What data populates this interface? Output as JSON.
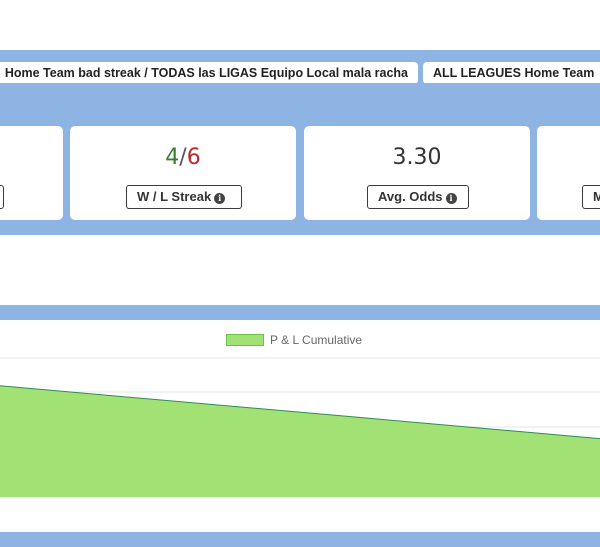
{
  "tabs": [
    {
      "label": "Home Team bad streak / TODAS las LIGAS Equipo Local mala racha"
    },
    {
      "label": "ALL LEAGUES Home Team"
    }
  ],
  "stats": [
    {
      "label": ""
    },
    {
      "wins": "4",
      "sep": "/",
      "losses": "6",
      "label": "W / L Streak"
    },
    {
      "value": "3.30",
      "label": "Avg. Odds"
    },
    {
      "label": "M"
    }
  ],
  "chart": {
    "legend": "P & L Cumulative",
    "fill_color": "#a2e274",
    "line_color": "#2e8b57",
    "info_icon": "info-circle-icon"
  },
  "chart_data": {
    "type": "area",
    "series": [
      {
        "name": "P & L Cumulative",
        "values": [
          0.8,
          0.42
        ]
      }
    ],
    "ylim": [
      0,
      1
    ],
    "grid": true
  }
}
